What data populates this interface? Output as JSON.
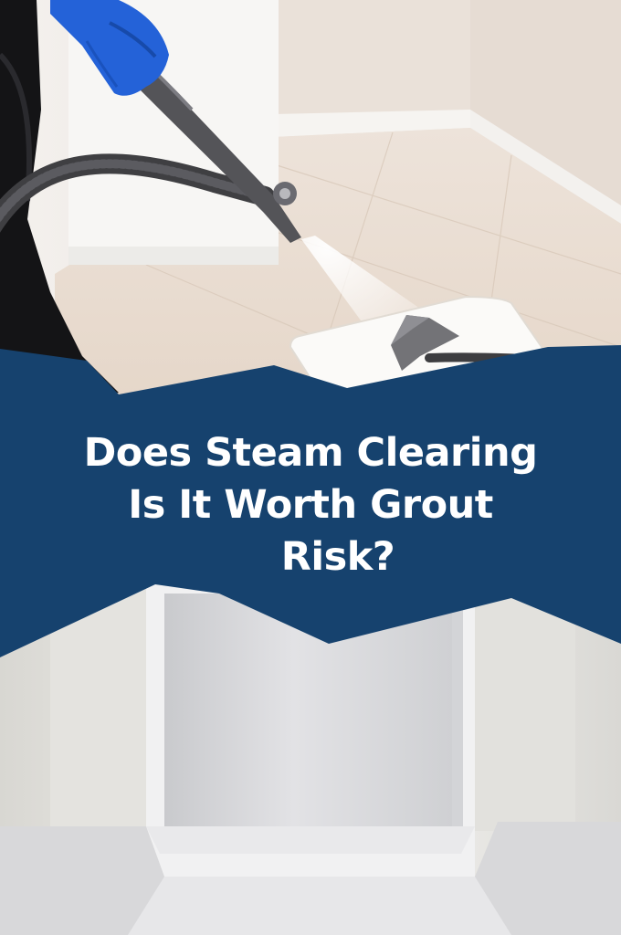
{
  "headline": {
    "line1": "Does Steam Clearing",
    "line2": "Is It Worth Grout",
    "line3": "Risk?"
  },
  "colors": {
    "banner": "#16426e",
    "glove": "#2462d8",
    "wall": "#ece6e1",
    "floor": "#e9dcd0",
    "steamer_body": "#5a5a5e",
    "appliance": "#d9d9dc"
  },
  "icons": [
    "steam-cleaner-wand-icon",
    "glove-icon",
    "steam-spray-icon",
    "floor-pad-icon",
    "appliance-icon"
  ]
}
